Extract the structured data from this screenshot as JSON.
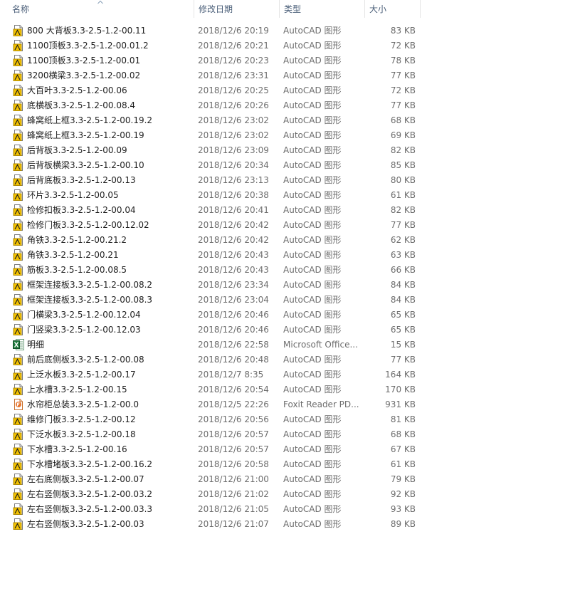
{
  "columns": {
    "name": "名称",
    "date": "修改日期",
    "type": "类型",
    "size": "大小"
  },
  "files": [
    {
      "icon": "autocad-icon",
      "name": "800 大背板3.3-2.5-1.2-00.11",
      "date": "2018/12/6 20:19",
      "type": "AutoCAD 图形",
      "size": "83 KB"
    },
    {
      "icon": "autocad-icon",
      "name": "1100顶板3.3-2.5-1.2-00.01.2",
      "date": "2018/12/6 20:21",
      "type": "AutoCAD 图形",
      "size": "72 KB"
    },
    {
      "icon": "autocad-icon",
      "name": "1100顶板3.3-2.5-1.2-00.01",
      "date": "2018/12/6 20:23",
      "type": "AutoCAD 图形",
      "size": "78 KB"
    },
    {
      "icon": "autocad-icon",
      "name": "3200横梁3.3-2.5-1.2-00.02",
      "date": "2018/12/6 23:31",
      "type": "AutoCAD 图形",
      "size": "77 KB"
    },
    {
      "icon": "autocad-icon",
      "name": "大百叶3.3-2.5-1.2-00.06",
      "date": "2018/12/6 20:25",
      "type": "AutoCAD 图形",
      "size": "72 KB"
    },
    {
      "icon": "autocad-icon",
      "name": "底横板3.3-2.5-1.2-00.08.4",
      "date": "2018/12/6 20:26",
      "type": "AutoCAD 图形",
      "size": "77 KB"
    },
    {
      "icon": "autocad-icon",
      "name": "蜂窝纸上框3.3-2.5-1.2-00.19.2",
      "date": "2018/12/6 23:02",
      "type": "AutoCAD 图形",
      "size": "68 KB"
    },
    {
      "icon": "autocad-icon",
      "name": "蜂窝纸上框3.3-2.5-1.2-00.19",
      "date": "2018/12/6 23:02",
      "type": "AutoCAD 图形",
      "size": "69 KB"
    },
    {
      "icon": "autocad-icon",
      "name": "后背板3.3-2.5-1.2-00.09",
      "date": "2018/12/6 23:09",
      "type": "AutoCAD 图形",
      "size": "82 KB"
    },
    {
      "icon": "autocad-icon",
      "name": "后背板横梁3.3-2.5-1.2-00.10",
      "date": "2018/12/6 20:34",
      "type": "AutoCAD 图形",
      "size": "85 KB"
    },
    {
      "icon": "autocad-icon",
      "name": "后背底板3.3-2.5-1.2-00.13",
      "date": "2018/12/6 23:13",
      "type": "AutoCAD 图形",
      "size": "80 KB"
    },
    {
      "icon": "autocad-icon",
      "name": "环片3.3-2.5-1.2-00.05",
      "date": "2018/12/6 20:38",
      "type": "AutoCAD 图形",
      "size": "61 KB"
    },
    {
      "icon": "autocad-icon",
      "name": "检修扣板3.3-2.5-1.2-00.04",
      "date": "2018/12/6 20:41",
      "type": "AutoCAD 图形",
      "size": "82 KB"
    },
    {
      "icon": "autocad-icon",
      "name": "检修门板3.3-2.5-1.2-00.12.02",
      "date": "2018/12/6 20:42",
      "type": "AutoCAD 图形",
      "size": "77 KB"
    },
    {
      "icon": "autocad-icon",
      "name": "角铁3.3-2.5-1.2-00.21.2",
      "date": "2018/12/6 20:42",
      "type": "AutoCAD 图形",
      "size": "62 KB"
    },
    {
      "icon": "autocad-icon",
      "name": "角铁3.3-2.5-1.2-00.21",
      "date": "2018/12/6 20:43",
      "type": "AutoCAD 图形",
      "size": "63 KB"
    },
    {
      "icon": "autocad-icon",
      "name": "筋板3.3-2.5-1.2-00.08.5",
      "date": "2018/12/6 20:43",
      "type": "AutoCAD 图形",
      "size": "66 KB"
    },
    {
      "icon": "autocad-icon",
      "name": "框架连接板3.3-2.5-1.2-00.08.2",
      "date": "2018/12/6 23:34",
      "type": "AutoCAD 图形",
      "size": "84 KB"
    },
    {
      "icon": "autocad-icon",
      "name": "框架连接板3.3-2.5-1.2-00.08.3",
      "date": "2018/12/6 23:04",
      "type": "AutoCAD 图形",
      "size": "84 KB"
    },
    {
      "icon": "autocad-icon",
      "name": "门横梁3.3-2.5-1.2-00.12.04",
      "date": "2018/12/6 20:46",
      "type": "AutoCAD 图形",
      "size": "65 KB"
    },
    {
      "icon": "autocad-icon",
      "name": "门竖梁3.3-2.5-1.2-00.12.03",
      "date": "2018/12/6 20:46",
      "type": "AutoCAD 图形",
      "size": "65 KB"
    },
    {
      "icon": "excel-icon",
      "name": "明细",
      "date": "2018/12/6 22:58",
      "type": "Microsoft Office...",
      "size": "15 KB"
    },
    {
      "icon": "autocad-icon",
      "name": "前后底侧板3.3-2.5-1.2-00.08",
      "date": "2018/12/6 20:48",
      "type": "AutoCAD 图形",
      "size": "77 KB"
    },
    {
      "icon": "autocad-icon",
      "name": "上泛水板3.3-2.5-1.2-00.17",
      "date": "2018/12/7 8:35",
      "type": "AutoCAD 图形",
      "size": "164 KB"
    },
    {
      "icon": "autocad-icon",
      "name": "上水槽3.3-2.5-1.2-00.15",
      "date": "2018/12/6 20:54",
      "type": "AutoCAD 图形",
      "size": "170 KB"
    },
    {
      "icon": "pdf-icon",
      "name": "水帘柜总装3.3-2.5-1.2-00.0",
      "date": "2018/12/5 22:26",
      "type": "Foxit Reader PD...",
      "size": "931 KB"
    },
    {
      "icon": "autocad-icon",
      "name": "维修门板3.3-2.5-1.2-00.12",
      "date": "2018/12/6 20:56",
      "type": "AutoCAD 图形",
      "size": "81 KB"
    },
    {
      "icon": "autocad-icon",
      "name": "下泛水板3.3-2.5-1.2-00.18",
      "date": "2018/12/6 20:57",
      "type": "AutoCAD 图形",
      "size": "68 KB"
    },
    {
      "icon": "autocad-icon",
      "name": "下水槽3.3-2.5-1.2-00.16",
      "date": "2018/12/6 20:57",
      "type": "AutoCAD 图形",
      "size": "67 KB"
    },
    {
      "icon": "autocad-icon",
      "name": "下水槽堵板3.3-2.5-1.2-00.16.2",
      "date": "2018/12/6 20:58",
      "type": "AutoCAD 图形",
      "size": "61 KB"
    },
    {
      "icon": "autocad-icon",
      "name": "左右底侧板3.3-2.5-1.2-00.07",
      "date": "2018/12/6 21:00",
      "type": "AutoCAD 图形",
      "size": "79 KB"
    },
    {
      "icon": "autocad-icon",
      "name": "左右竖侧板3.3-2.5-1.2-00.03.2",
      "date": "2018/12/6 21:02",
      "type": "AutoCAD 图形",
      "size": "92 KB"
    },
    {
      "icon": "autocad-icon",
      "name": "左右竖侧板3.3-2.5-1.2-00.03.3",
      "date": "2018/12/6 21:05",
      "type": "AutoCAD 图形",
      "size": "93 KB"
    },
    {
      "icon": "autocad-icon",
      "name": "左右竖侧板3.3-2.5-1.2-00.03",
      "date": "2018/12/6 21:07",
      "type": "AutoCAD 图形",
      "size": "89 KB"
    }
  ],
  "colors": {
    "header_text": "#4c607a",
    "name_text": "#1e1e1e",
    "detail_text": "#6d6d6d",
    "autocad_yellow": "#f3c200",
    "excel_green": "#1f7a3d",
    "pdf_orange": "#e8742c"
  }
}
